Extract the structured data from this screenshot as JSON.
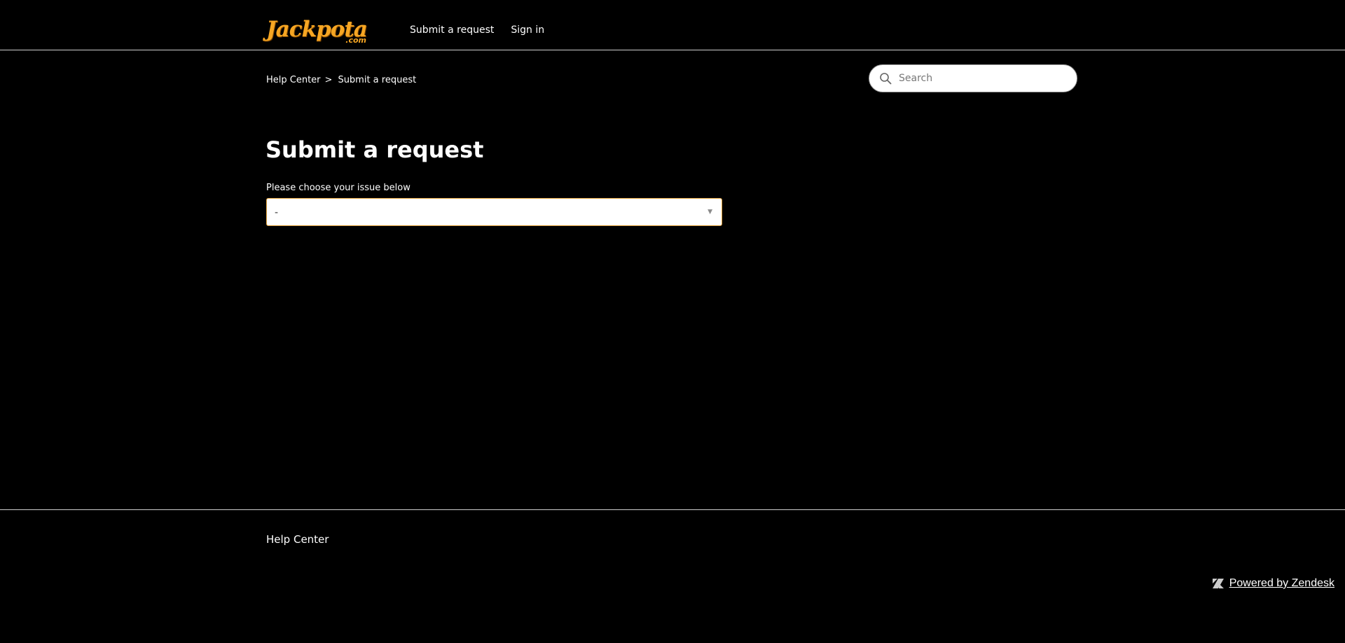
{
  "header": {
    "logo_text": "Jackpota",
    "logo_suffix": ".com",
    "nav": {
      "submit_request": "Submit a request",
      "sign_in": "Sign in"
    }
  },
  "breadcrumbs": {
    "items": [
      "Help Center",
      "Submit a request"
    ],
    "separator": ">"
  },
  "search": {
    "placeholder": "Search",
    "icon": "search-icon"
  },
  "main": {
    "title": "Submit a request",
    "issue_label": "Please choose your issue below",
    "issue_value": "-"
  },
  "footer": {
    "help_center": "Help Center",
    "powered_by": "Powered by Zendesk"
  },
  "colors": {
    "background": "#000000",
    "text": "#ffffff",
    "brand": "#f6a623",
    "select_border": "#e3a33a",
    "divider": "#cfcfcf"
  }
}
